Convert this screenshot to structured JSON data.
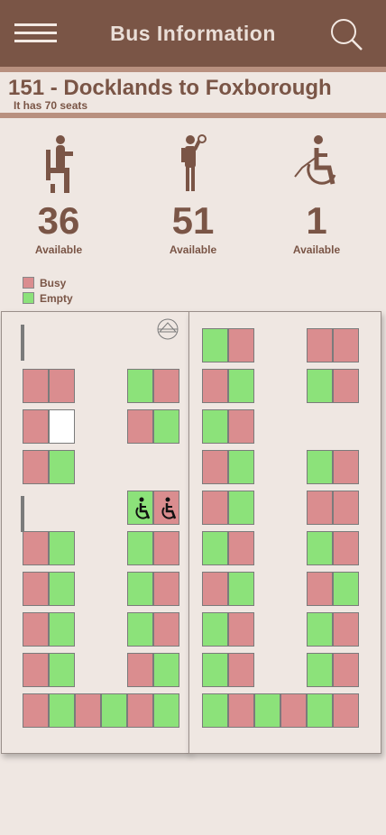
{
  "header": {
    "title": "Bus Information",
    "menu_icon": "hamburger-menu-icon",
    "search_icon": "search-icon"
  },
  "route": {
    "name": "151 - Docklands to Foxborough",
    "seats_text": "It has 70 seats"
  },
  "stats": [
    {
      "icon": "seated-passenger-icon",
      "count": "36",
      "label": "Available"
    },
    {
      "icon": "standing-passenger-icon",
      "count": "51",
      "label": "Available"
    },
    {
      "icon": "wheelchair-icon",
      "count": "1",
      "label": "Available"
    }
  ],
  "legend": [
    {
      "label": "Busy",
      "color": "#da8d8f"
    },
    {
      "label": "Empty",
      "color": "#8ce27a"
    }
  ],
  "colors": {
    "brand": "#7a5546",
    "busy": "#da8d8f",
    "empty": "#8ce27a",
    "background": "#efe7e2"
  },
  "seat_map": {
    "front_section": [
      [
        "busy",
        "busy",
        null,
        null,
        "empty",
        "busy"
      ],
      [
        "busy",
        "blank",
        null,
        null,
        "busy",
        "empty"
      ],
      [
        "busy",
        "empty",
        null,
        null,
        null,
        null
      ],
      [
        null,
        null,
        null,
        null,
        "wheelchair-empty",
        "wheelchair-busy"
      ],
      [
        "busy",
        "empty",
        null,
        null,
        "empty",
        "busy"
      ],
      [
        "busy",
        "empty",
        null,
        null,
        "empty",
        "busy"
      ],
      [
        "busy",
        "empty",
        null,
        null,
        "empty",
        "busy"
      ],
      [
        "busy",
        "empty",
        null,
        null,
        "busy",
        "empty"
      ],
      [
        "busy",
        "empty",
        "busy",
        "empty",
        "busy",
        "empty"
      ]
    ],
    "rear_section": [
      [
        "empty",
        "busy",
        null,
        null,
        "busy",
        "busy"
      ],
      [
        "busy",
        "empty",
        null,
        null,
        "empty",
        "busy"
      ],
      [
        "empty",
        "busy",
        null,
        null,
        null,
        null
      ],
      [
        "busy",
        "empty",
        null,
        null,
        "empty",
        "busy"
      ],
      [
        "busy",
        "empty",
        null,
        null,
        "busy",
        "busy"
      ],
      [
        "empty",
        "busy",
        null,
        null,
        "empty",
        "busy"
      ],
      [
        "busy",
        "empty",
        null,
        null,
        "busy",
        "empty"
      ],
      [
        "empty",
        "busy",
        null,
        null,
        "empty",
        "busy"
      ],
      [
        "empty",
        "busy",
        null,
        null,
        "empty",
        "busy"
      ],
      [
        "empty",
        "busy",
        "empty",
        "busy",
        "empty",
        "busy"
      ]
    ]
  }
}
